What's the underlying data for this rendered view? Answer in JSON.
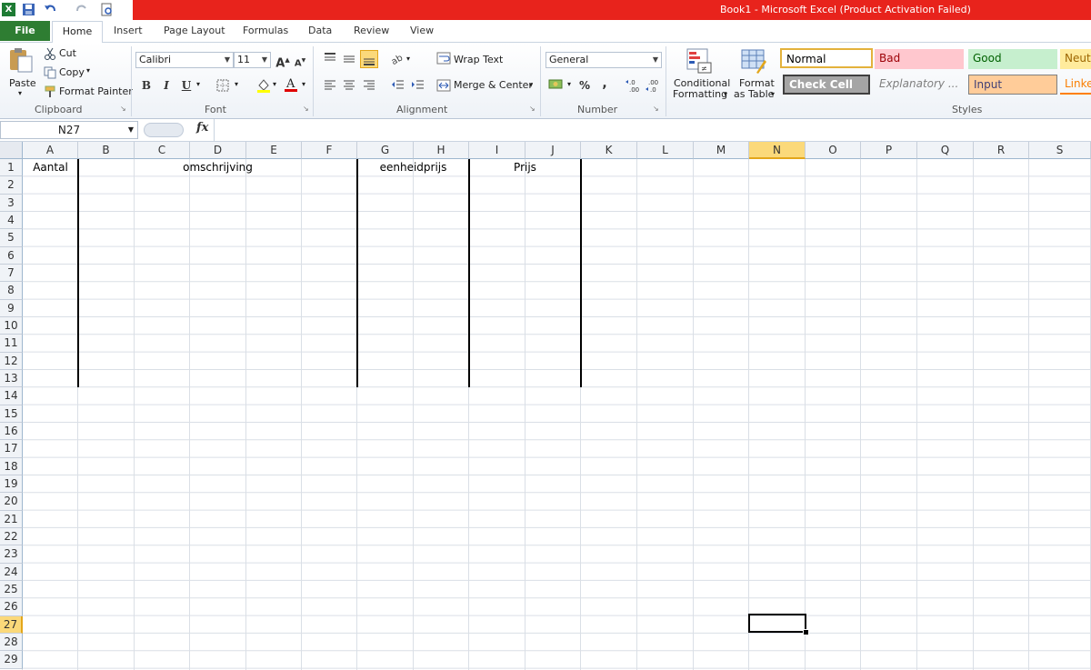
{
  "titlebar": {
    "title": "Book1  -  Microsoft Excel (Product Activation Failed)"
  },
  "tabs": [
    "File",
    "Home",
    "Insert",
    "Page Layout",
    "Formulas",
    "Data",
    "Review",
    "View"
  ],
  "clipboard": {
    "paste": "Paste",
    "cut": "Cut",
    "copy": "Copy",
    "format_painter": "Format Painter",
    "label": "Clipboard"
  },
  "font": {
    "name": "Calibri",
    "size": "11",
    "bold": "B",
    "italic": "I",
    "underline": "U",
    "label": "Font"
  },
  "alignment": {
    "wrap_text": "Wrap Text",
    "merge_center": "Merge & Center",
    "label": "Alignment"
  },
  "number": {
    "format": "General",
    "percent": "%",
    "comma": ",",
    "label": "Number"
  },
  "styles": {
    "conditional_1": "Conditional",
    "conditional_2": "Formatting",
    "format_table_1": "Format",
    "format_table_2": "as Table",
    "normal": "Normal",
    "bad": "Bad",
    "good": "Good",
    "neutral": "Neut",
    "check_cell": "Check Cell",
    "explanatory": "Explanatory ...",
    "input": "Input",
    "linked": "Linke",
    "label": "Styles"
  },
  "formula_bar": {
    "name_box": "N27",
    "fx": "fx",
    "value": ""
  },
  "sheet": {
    "columns": [
      "A",
      "B",
      "C",
      "D",
      "E",
      "F",
      "G",
      "H",
      "I",
      "J",
      "K",
      "L",
      "M",
      "N",
      "O",
      "P",
      "Q",
      "R",
      "S"
    ],
    "rows": [
      "1",
      "2",
      "3",
      "4",
      "5",
      "6",
      "7",
      "8",
      "9",
      "10",
      "11",
      "12",
      "13",
      "14",
      "15",
      "16",
      "17",
      "18",
      "19",
      "20",
      "21",
      "22",
      "23",
      "24",
      "25",
      "26",
      "27",
      "28",
      "29"
    ],
    "cells": {
      "A1": "Aantal",
      "B1": "omschrijving",
      "G1": "eenheidprijs",
      "I1": "Prijs"
    },
    "selected_column": "N",
    "selected_row": "27"
  },
  "colors": {
    "title_red": "#e8231c",
    "file_green": "#2e7d32",
    "selection_yellow": "#fbd97a"
  }
}
